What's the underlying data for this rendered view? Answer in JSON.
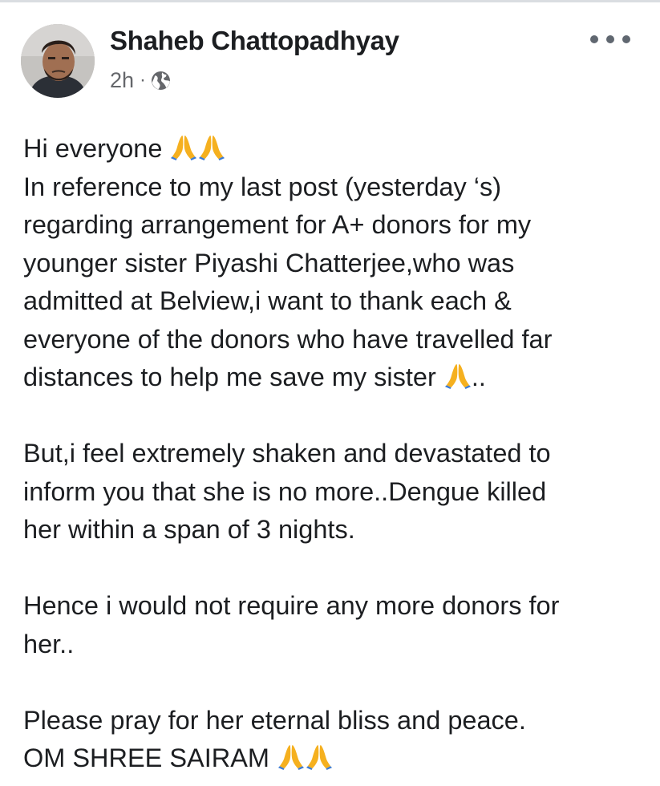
{
  "post": {
    "author": "Shaheb Chattopadhyay",
    "time": "2h",
    "separator": "·",
    "privacy_icon": "globe-icon",
    "more_icon": "more-options-icon",
    "lines": [
      "Hi everyone",
      "In reference to my last post (yesterday ‘s)",
      "regarding arrangement for A+ donors for my",
      "younger sister Piyashi Chatterjee,who was",
      "admitted at Belview,i want to thank each &",
      "everyone of the donors who have travelled far",
      "distances to help me save my sister",
      "..",
      "But,i feel extremely shaken and devastated to",
      "inform you that she is no more..Dengue killed",
      "her within a span of 3 nights.",
      "Hence i would not require any more donors for",
      "her..",
      "Please pray for her eternal bliss and peace.",
      "OM SHREE SAIRAM"
    ],
    "emoji_icon": "folded-hands-emoji"
  },
  "colors": {
    "text": "#1c1e21",
    "secondary_text": "#65676b",
    "emoji": "#f5b01f"
  }
}
